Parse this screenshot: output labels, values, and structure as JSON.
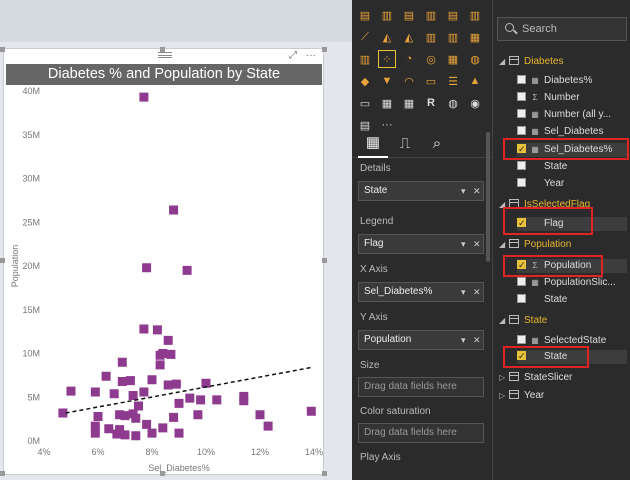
{
  "chart_data": {
    "type": "scatter",
    "title": "Diabetes % and Population by State",
    "xlabel": "Sel_Diabetes%",
    "ylabel": "Population",
    "x_ticks": [
      "4%",
      "6%",
      "8%",
      "10%",
      "12%",
      "14%"
    ],
    "y_ticks": [
      "0M",
      "5M",
      "10M",
      "15M",
      "20M",
      "25M",
      "30M",
      "35M",
      "40M"
    ],
    "xlim": [
      4,
      14
    ],
    "ylim": [
      0,
      40
    ],
    "marker_color": "#8e3a8e",
    "trendline": {
      "x": [
        4.8,
        13.9
      ],
      "y": [
        3.2,
        8.4
      ],
      "style": "dashed"
    },
    "points": [
      {
        "x": 7.7,
        "y": 39.3
      },
      {
        "x": 8.8,
        "y": 26.4
      },
      {
        "x": 7.8,
        "y": 19.8
      },
      {
        "x": 9.3,
        "y": 19.5
      },
      {
        "x": 7.7,
        "y": 12.8
      },
      {
        "x": 8.2,
        "y": 12.7
      },
      {
        "x": 8.6,
        "y": 11.5
      },
      {
        "x": 8.4,
        "y": 10.0
      },
      {
        "x": 8.7,
        "y": 9.9
      },
      {
        "x": 8.3,
        "y": 9.8
      },
      {
        "x": 6.9,
        "y": 9.0
      },
      {
        "x": 8.3,
        "y": 8.7
      },
      {
        "x": 7.2,
        "y": 6.9
      },
      {
        "x": 6.3,
        "y": 7.4
      },
      {
        "x": 8.0,
        "y": 7.0
      },
      {
        "x": 6.9,
        "y": 6.8
      },
      {
        "x": 10.0,
        "y": 6.6
      },
      {
        "x": 8.9,
        "y": 6.5
      },
      {
        "x": 8.6,
        "y": 6.4
      },
      {
        "x": 5.0,
        "y": 5.7
      },
      {
        "x": 5.9,
        "y": 5.6
      },
      {
        "x": 6.6,
        "y": 5.4
      },
      {
        "x": 7.3,
        "y": 5.2
      },
      {
        "x": 7.7,
        "y": 5.6
      },
      {
        "x": 9.4,
        "y": 4.9
      },
      {
        "x": 10.4,
        "y": 4.7
      },
      {
        "x": 11.4,
        "y": 5.1
      },
      {
        "x": 9.8,
        "y": 4.7
      },
      {
        "x": 11.4,
        "y": 4.6
      },
      {
        "x": 7.5,
        "y": 4.0
      },
      {
        "x": 9.0,
        "y": 4.3
      },
      {
        "x": 4.7,
        "y": 3.2
      },
      {
        "x": 6.0,
        "y": 2.8
      },
      {
        "x": 6.8,
        "y": 3.0
      },
      {
        "x": 7.3,
        "y": 3.1
      },
      {
        "x": 7.0,
        "y": 2.9
      },
      {
        "x": 7.4,
        "y": 2.6
      },
      {
        "x": 8.8,
        "y": 2.7
      },
      {
        "x": 9.7,
        "y": 3.0
      },
      {
        "x": 12.0,
        "y": 3.0
      },
      {
        "x": 13.9,
        "y": 3.4
      },
      {
        "x": 5.9,
        "y": 1.7
      },
      {
        "x": 6.4,
        "y": 1.4
      },
      {
        "x": 6.8,
        "y": 1.3
      },
      {
        "x": 7.8,
        "y": 1.9
      },
      {
        "x": 8.4,
        "y": 1.5
      },
      {
        "x": 5.9,
        "y": 0.9
      },
      {
        "x": 6.7,
        "y": 0.8
      },
      {
        "x": 7.0,
        "y": 0.7
      },
      {
        "x": 7.4,
        "y": 0.6
      },
      {
        "x": 8.0,
        "y": 0.9
      },
      {
        "x": 9.0,
        "y": 0.9
      },
      {
        "x": 12.3,
        "y": 1.7
      }
    ]
  },
  "visual_header": {
    "focus_icon": "focus-mode-icon",
    "more_icon": "more-options-icon"
  },
  "viz_pane": {
    "icon_colors": {
      "accent": "#e8a33a",
      "selected_border": "#e8c33a"
    },
    "tabs": [
      "fields-tab-icon",
      "format-roller-icon",
      "analytics-magnifier-icon"
    ],
    "wells": [
      {
        "label": "Details",
        "value": "State"
      },
      {
        "label": "Legend",
        "value": "Flag"
      },
      {
        "label": "X Axis",
        "value": "Sel_Diabetes%"
      },
      {
        "label": "Y Axis",
        "value": "Population"
      },
      {
        "label": "Size",
        "value": "Drag data fields here"
      },
      {
        "label": "Color saturation",
        "value": "Drag data fields here"
      },
      {
        "label": "Play Axis",
        "value": ""
      }
    ]
  },
  "fields_pane": {
    "search_placeholder": "Search",
    "tables": [
      {
        "name": "Diabetes",
        "fields": [
          "Diabetes%",
          "Number",
          "Number (all y...",
          "Sel_Diabetes",
          "Sel_Diabetes%",
          "State",
          "Year"
        ]
      },
      {
        "name": "IsSelectedFlag",
        "fields": [
          "Flag"
        ]
      },
      {
        "name": "Population",
        "fields": [
          "Population",
          "PopulationSlic...",
          "State"
        ]
      },
      {
        "name": "State",
        "fields": [
          "SelectedState",
          "State"
        ]
      },
      {
        "name": "StateSlicer",
        "fields": []
      },
      {
        "name": "Year",
        "fields": []
      }
    ],
    "highlight_color": "#e02424"
  }
}
